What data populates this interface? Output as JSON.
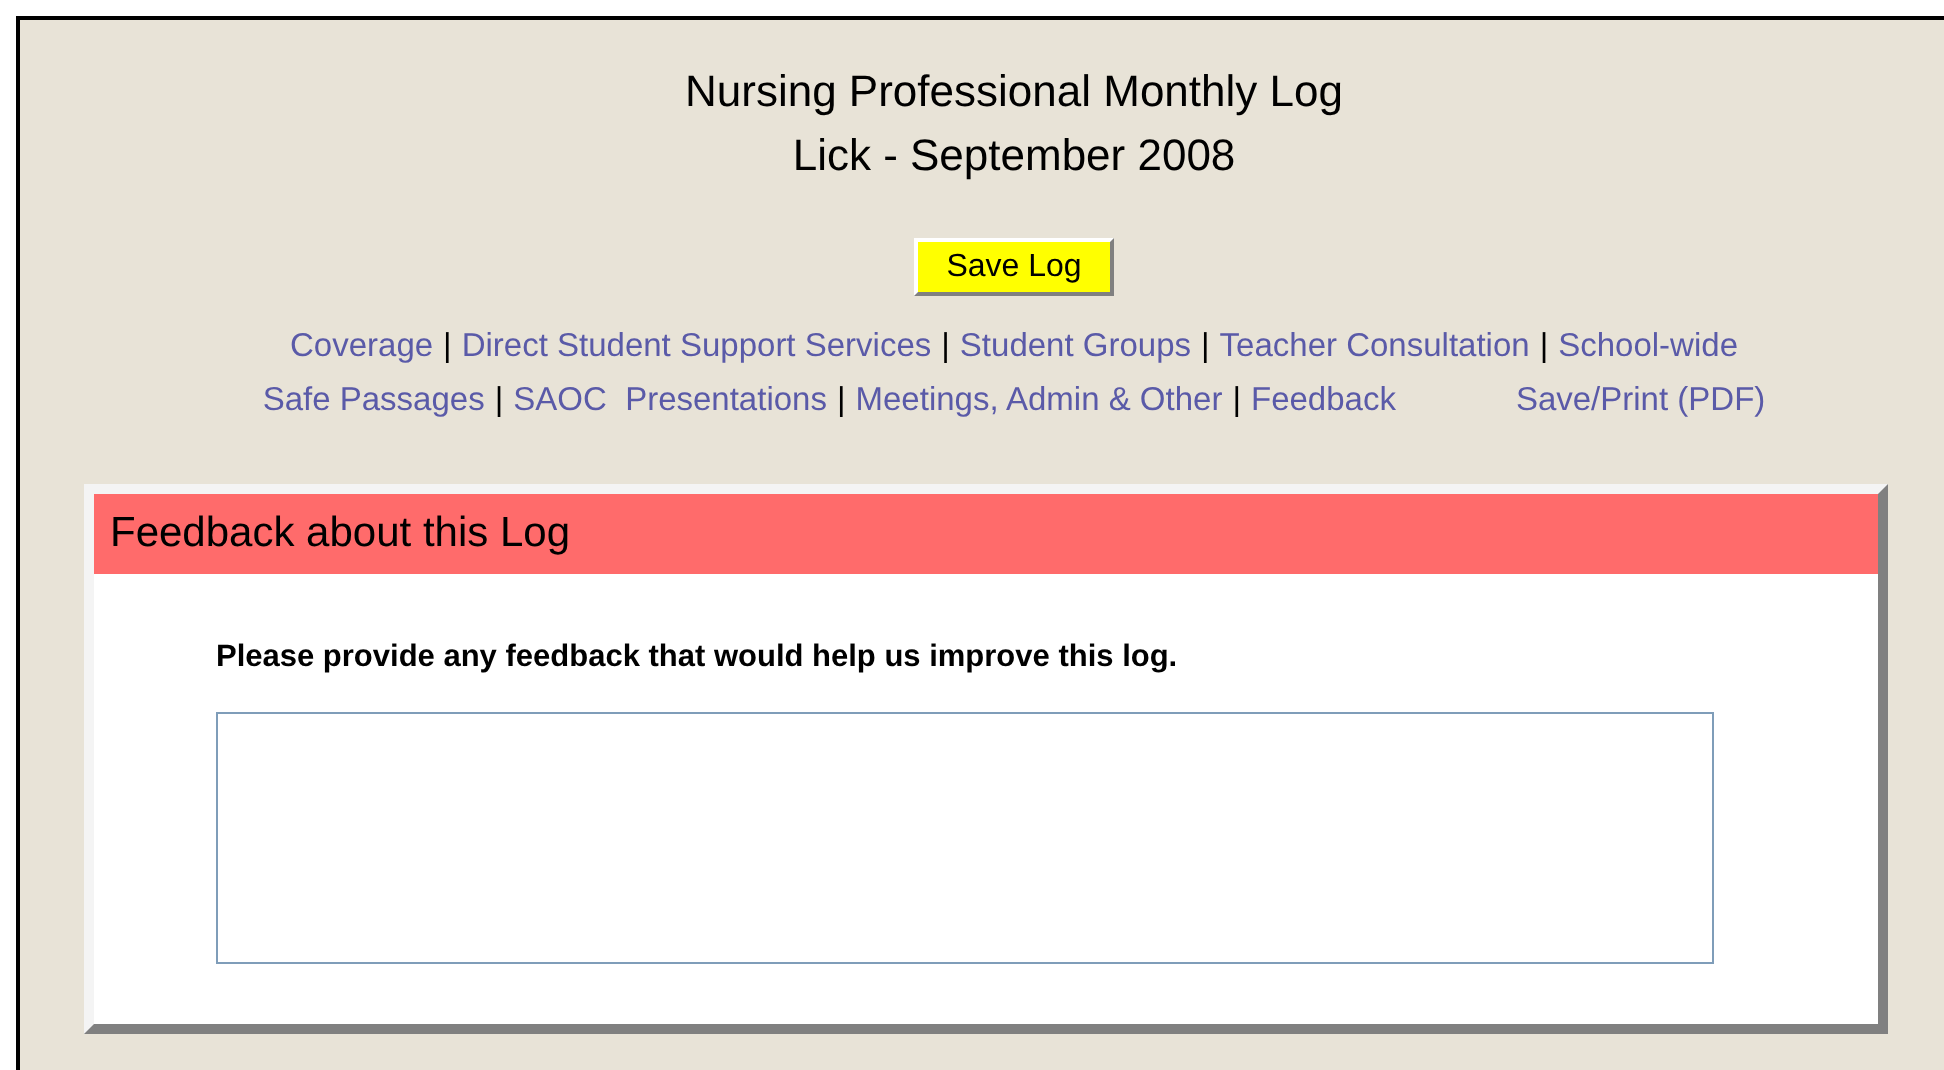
{
  "title_lines": [
    "Nursing Professional Monthly Log",
    "Lick - September 2008"
  ],
  "save_button": "Save Log",
  "nav": {
    "separator": "|",
    "rows": [
      {
        "links": [
          "Coverage",
          "Direct Student Support Services",
          "Student Groups",
          "Teacher Consultation",
          "School-wide"
        ],
        "extra": null
      },
      {
        "links": [
          "Safe Passages",
          "SAOC  Presentations",
          "Meetings, Admin & Other",
          "Feedback"
        ],
        "extra": "Save/Print (PDF)"
      }
    ]
  },
  "panel": {
    "title": "Feedback about this Log",
    "prompt": "Please provide any feedback that would help us improve this log."
  }
}
